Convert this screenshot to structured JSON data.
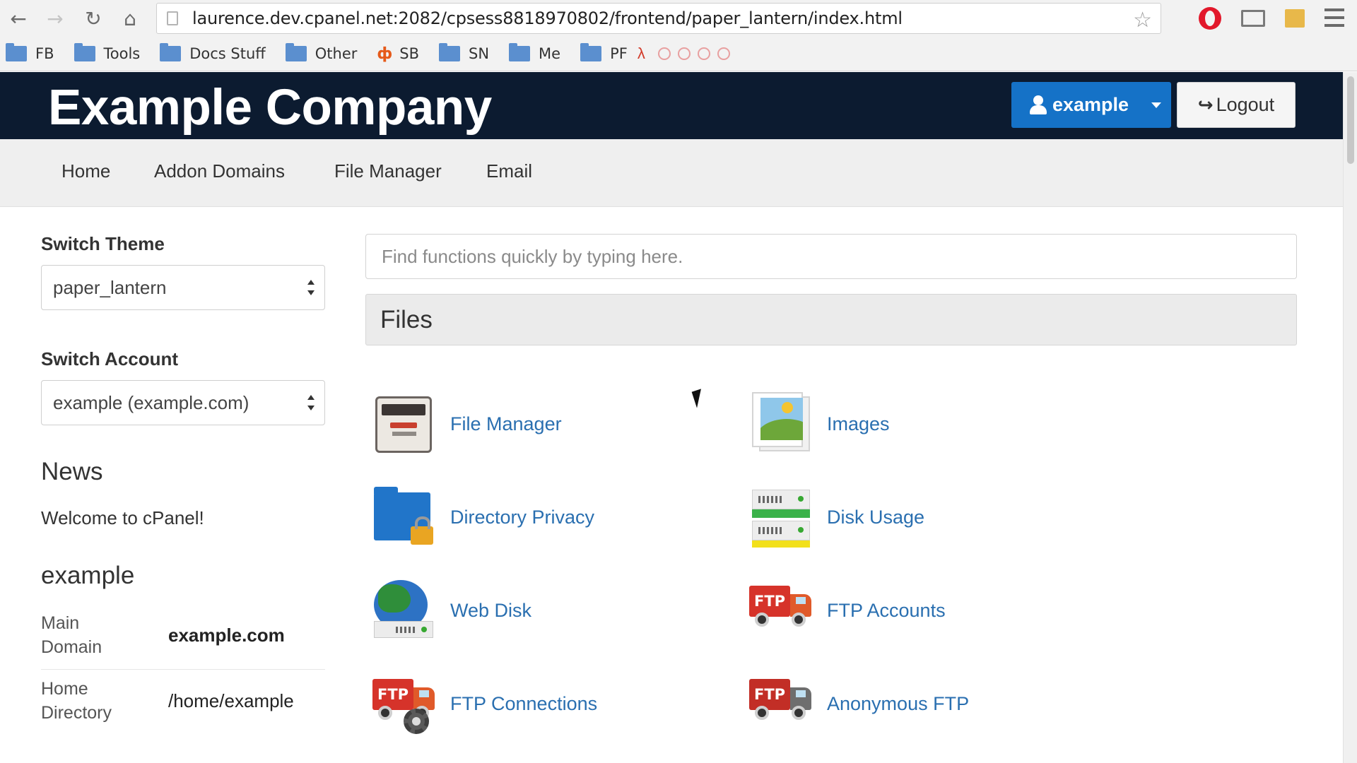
{
  "browser": {
    "url": "laurence.dev.cpanel.net:2082/cpsess8818970802/frontend/paper_lantern/index.html",
    "bookmarks": [
      {
        "label": "FB",
        "icon": "folder-icon"
      },
      {
        "label": "Tools",
        "icon": "folder-icon"
      },
      {
        "label": "Docs Stuff",
        "icon": "folder-icon"
      },
      {
        "label": "Other",
        "icon": "folder-icon"
      },
      {
        "label": "SB",
        "icon": "sb-logo-icon"
      },
      {
        "label": "SN",
        "icon": "folder-icon"
      },
      {
        "label": "Me",
        "icon": "folder-icon"
      },
      {
        "label": "PF",
        "icon": "folder-icon"
      }
    ]
  },
  "header": {
    "brand": "Example Company",
    "user_label": "example",
    "logout_label": "Logout",
    "accent": "#1572c7",
    "bar_color": "#0c1b30"
  },
  "nav": {
    "items": [
      "Home",
      "Addon Domains",
      "File Manager",
      "Email"
    ]
  },
  "sidebar": {
    "switch_theme_label": "Switch Theme",
    "theme_value": "paper_lantern",
    "switch_account_label": "Switch Account",
    "account_value": "example (example.com)",
    "news_heading": "News",
    "news_text": "Welcome to cPanel!",
    "account_heading": "example",
    "stats": [
      {
        "key_line1": "Main",
        "key_line2": "Domain",
        "value": "example.com"
      },
      {
        "key_line1": "Home",
        "key_line2": "Directory",
        "value": "/home/example"
      }
    ]
  },
  "main": {
    "search_placeholder": "Find functions quickly by typing here.",
    "group_title": "Files",
    "items": [
      {
        "label": "File Manager",
        "icon": "file-cabinet-icon"
      },
      {
        "label": "Images",
        "icon": "images-icon"
      },
      {
        "label": "Directory Privacy",
        "icon": "folder-lock-icon"
      },
      {
        "label": "Disk Usage",
        "icon": "disk-usage-icon"
      },
      {
        "label": "Web Disk",
        "icon": "web-disk-icon"
      },
      {
        "label": "FTP Accounts",
        "icon": "ftp-truck-icon"
      },
      {
        "label": "FTP Connections",
        "icon": "ftp-truck-gear-icon"
      },
      {
        "label": "Anonymous FTP",
        "icon": "ftp-truck-dark-icon"
      }
    ],
    "link_color": "#2a6fb0"
  }
}
